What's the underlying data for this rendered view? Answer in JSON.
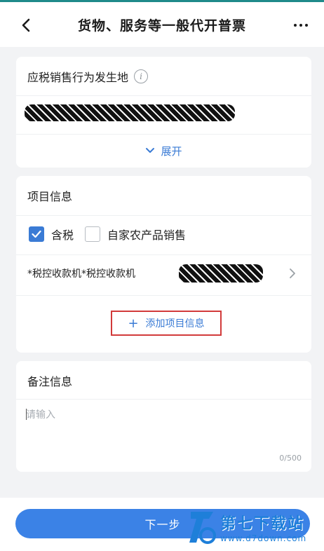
{
  "colors": {
    "accent": "#3a7bd5",
    "primary_button": "#3b82e6",
    "highlight_border": "#d23a3a",
    "background": "#f2f3f5"
  },
  "header": {
    "title": "货物、服务等一般代开普票",
    "back_icon": "chevron-left-icon",
    "more_icon": "more-horizontal-icon"
  },
  "location_card": {
    "label": "应税销售行为发生地",
    "info_icon": "info-icon",
    "expand_label": "展开"
  },
  "items_card": {
    "title": "项目信息",
    "checkboxes": [
      {
        "label": "含税",
        "checked": true
      },
      {
        "label": "自家农产品销售",
        "checked": false
      }
    ],
    "item": {
      "name": "*税控收款机*税控收款机"
    },
    "add_label": "添加项目信息"
  },
  "notes_card": {
    "title": "备注信息",
    "placeholder": "请输入",
    "value": "",
    "counter": "0/500"
  },
  "footer": {
    "next_label": "下一步"
  },
  "watermark": {
    "title": "第七下载站",
    "url": "www.d7down.com"
  }
}
